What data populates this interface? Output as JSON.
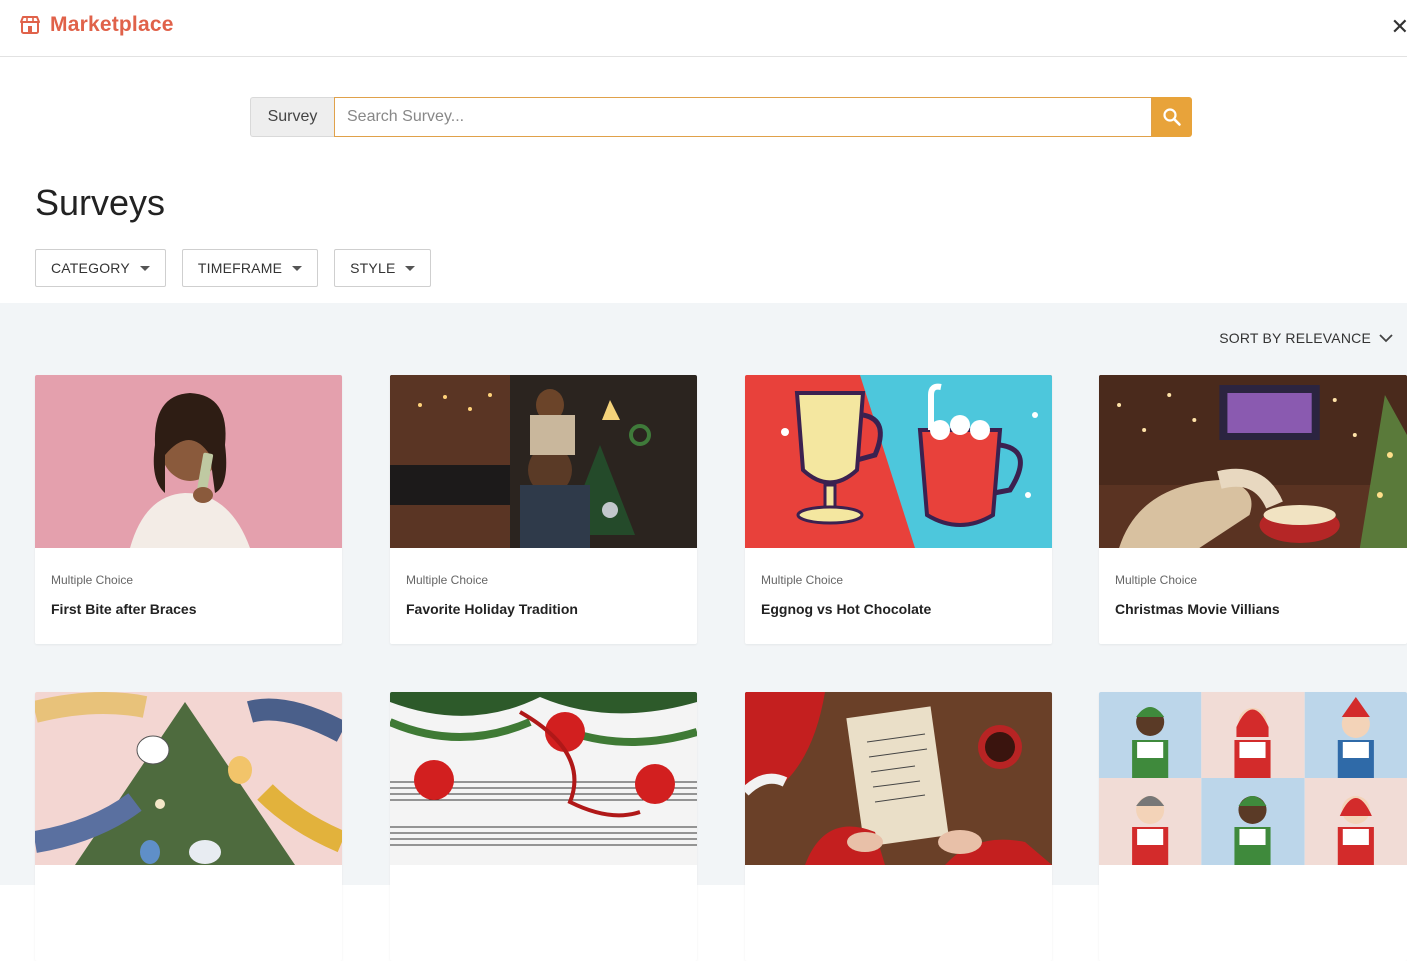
{
  "header": {
    "brand": "Marketplace",
    "brand_icon": "storefront-icon",
    "close_icon": "close-icon"
  },
  "search": {
    "scope_label": "Survey",
    "placeholder": "Search Survey...",
    "value": "",
    "button_icon": "search-icon"
  },
  "page": {
    "title": "Surveys"
  },
  "filters": [
    {
      "label": "CATEGORY"
    },
    {
      "label": "TIMEFRAME"
    },
    {
      "label": "STYLE"
    }
  ],
  "sort": {
    "label": "SORT BY RELEVANCE"
  },
  "cards": [
    {
      "type": "Multiple Choice",
      "title": "First Bite after Braces",
      "image": "smiling-girl-pink-background"
    },
    {
      "type": "Multiple Choice",
      "title": "Favorite Holiday Tradition",
      "image": "father-son-christmas-tree"
    },
    {
      "type": "Multiple Choice",
      "title": "Eggnog vs Hot Chocolate",
      "image": "eggnog-hot-chocolate-illustration"
    },
    {
      "type": "Multiple Choice",
      "title": "Christmas Movie Villians",
      "image": "cozy-movie-night-popcorn"
    },
    {
      "type": "",
      "title": "",
      "image": "hands-decorating-tree-illustration"
    },
    {
      "type": "",
      "title": "",
      "image": "ornaments-sheet-music"
    },
    {
      "type": "",
      "title": "",
      "image": "santa-letter"
    },
    {
      "type": "",
      "title": "",
      "image": "carolers-grid-illustration"
    }
  ],
  "colors": {
    "brand": "#e0624a",
    "accent": "#e8a33a",
    "results_bg": "#f2f5f7"
  }
}
